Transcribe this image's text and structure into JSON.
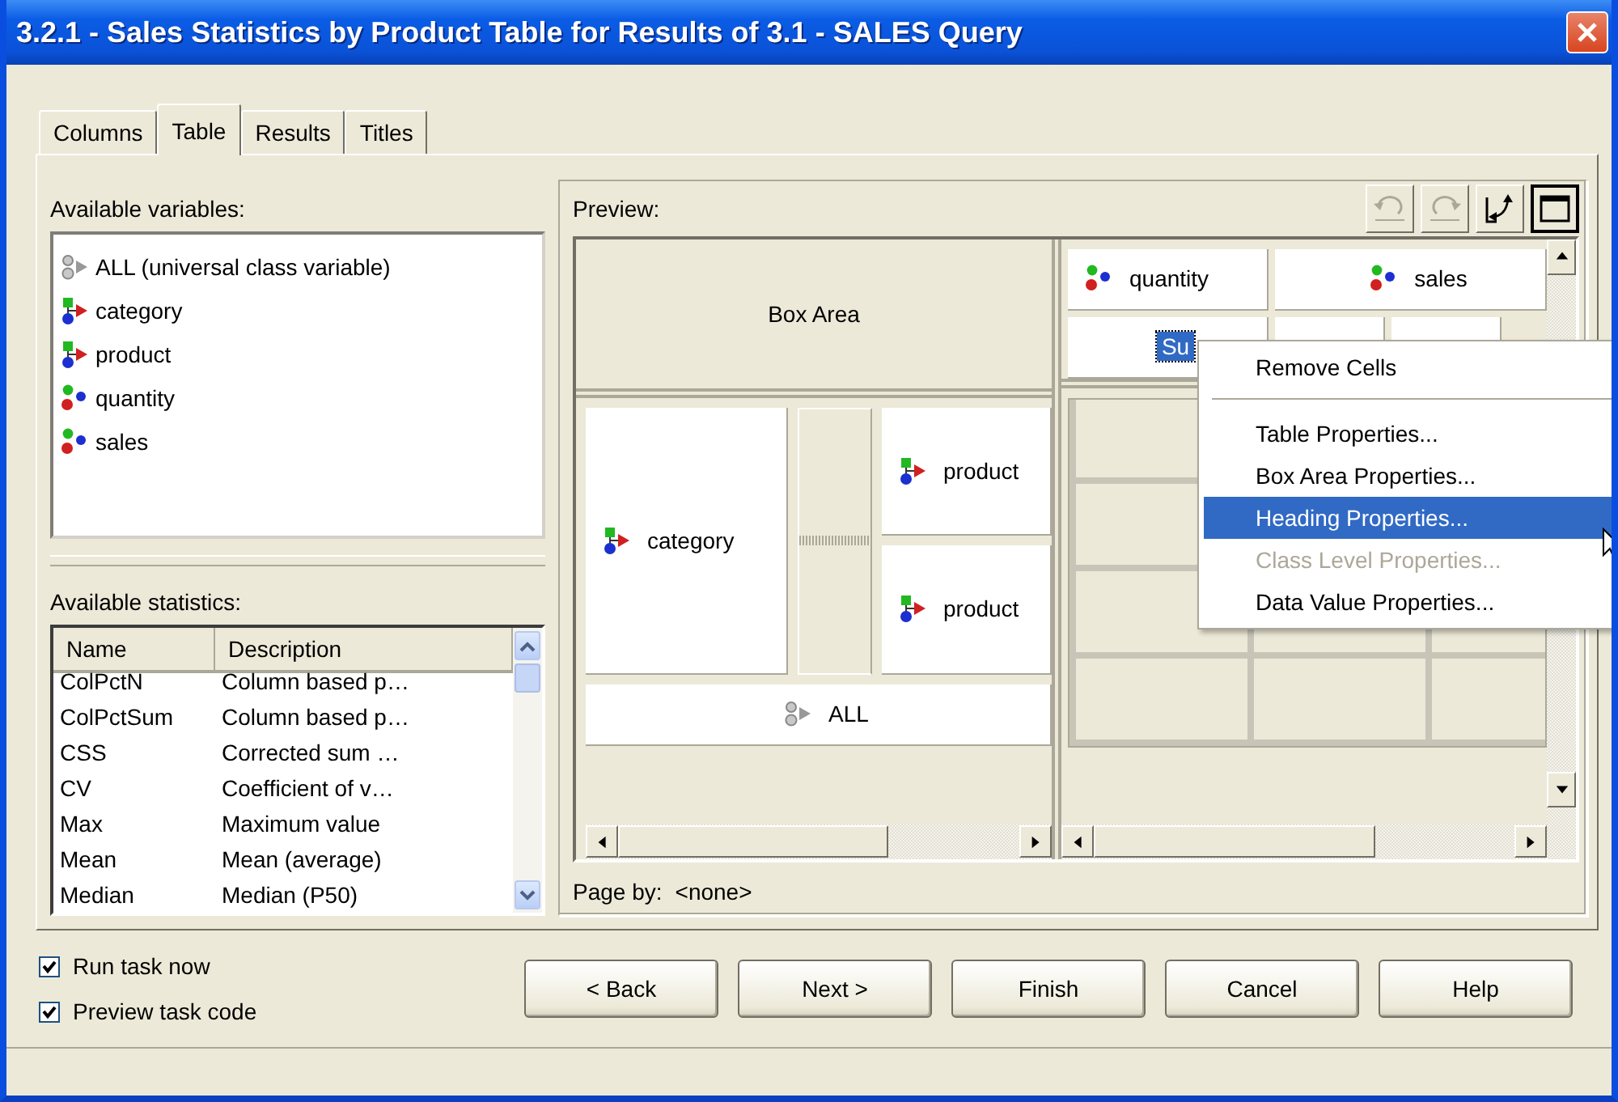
{
  "window": {
    "title": "3.2.1 - Sales Statistics by Product Table for Results of 3.1 - SALES Query"
  },
  "tabs": [
    {
      "label": "Columns",
      "selected": false
    },
    {
      "label": "Table",
      "selected": true
    },
    {
      "label": "Results",
      "selected": false
    },
    {
      "label": "Titles",
      "selected": false
    }
  ],
  "variables": {
    "label": "Available variables:",
    "items": [
      {
        "name": "ALL (universal class variable)",
        "kind": "universal"
      },
      {
        "name": "category",
        "kind": "class"
      },
      {
        "name": "product",
        "kind": "class"
      },
      {
        "name": "quantity",
        "kind": "analysis"
      },
      {
        "name": "sales",
        "kind": "analysis"
      }
    ]
  },
  "statistics": {
    "label": "Available statistics:",
    "columns": [
      "Name",
      "Description"
    ],
    "rows": [
      [
        "ColPctN",
        "Column based p…"
      ],
      [
        "ColPctSum",
        "Column based p…"
      ],
      [
        "CSS",
        "Corrected sum …"
      ],
      [
        "CV",
        "Coefficient of v…"
      ],
      [
        "Max",
        "Maximum value"
      ],
      [
        "Mean",
        "Mean (average)"
      ],
      [
        "Median",
        "Median (P50)"
      ]
    ]
  },
  "preview": {
    "label": "Preview:",
    "toolbar": [
      {
        "kind": "undo",
        "disabled": true
      },
      {
        "kind": "redo",
        "disabled": true
      },
      {
        "kind": "swap",
        "disabled": false
      },
      {
        "kind": "maximize",
        "disabled": false
      }
    ],
    "box_area": "Box Area",
    "column_headings": [
      {
        "name": "quantity",
        "kind": "analysis"
      },
      {
        "name": "sales",
        "kind": "analysis"
      }
    ],
    "statistic_headings": [
      {
        "label": "Su",
        "selected": true
      }
    ],
    "row_headings": [
      {
        "name": "category",
        "kind": "class",
        "children": [
          {
            "name": "product",
            "kind": "class"
          },
          {
            "name": "product",
            "kind": "class"
          }
        ]
      }
    ],
    "total_row": {
      "name": "ALL",
      "kind": "universal"
    },
    "page_by_label": "Page by:",
    "page_by_value": "<none>"
  },
  "context_menu": {
    "items": [
      {
        "kind": "item",
        "label": "Remove Cells",
        "selected": false,
        "disabled": false
      },
      {
        "kind": "separator"
      },
      {
        "kind": "item",
        "label": "Table Properties...",
        "selected": false,
        "disabled": false
      },
      {
        "kind": "item",
        "label": "Box Area Properties...",
        "selected": false,
        "disabled": false
      },
      {
        "kind": "item",
        "label": "Heading Properties...",
        "selected": true,
        "disabled": false
      },
      {
        "kind": "item",
        "label": "Class Level Properties...",
        "selected": false,
        "disabled": true
      },
      {
        "kind": "item",
        "label": "Data Value Properties...",
        "selected": false,
        "disabled": false
      }
    ]
  },
  "options": [
    {
      "label": "Run task now",
      "checked": true
    },
    {
      "label": "Preview task code",
      "checked": true
    }
  ],
  "buttons": [
    "< Back",
    "Next >",
    "Finish",
    "Cancel",
    "Help"
  ]
}
